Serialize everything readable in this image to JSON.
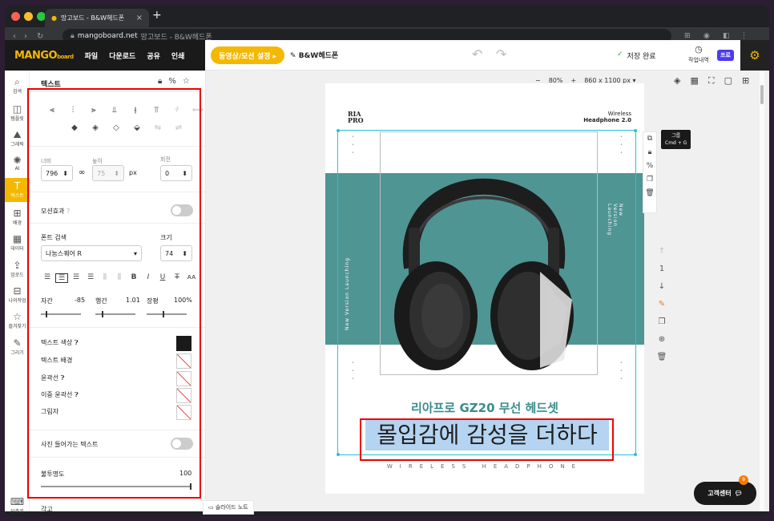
{
  "browser": {
    "tab_title": "망고보드 - B&W헤드폰",
    "url_host": "mangoboard.net",
    "url_rest": "망고보드 - B&W헤드폰"
  },
  "app": {
    "menu": [
      "파일",
      "다운로드",
      "공유",
      "인쇄"
    ],
    "motion_button": "동영상/모션 설정 ▸",
    "doc_title": "B&W헤드폰",
    "saved": "저장 완료",
    "history": "작업내역",
    "pro": "프로",
    "brand": "MANGO",
    "brand_small": "board"
  },
  "leftbar": [
    {
      "icon": "⌕",
      "label": "검색"
    },
    {
      "icon": "◫",
      "label": "템플릿"
    },
    {
      "icon": "⛰",
      "label": "그래픽"
    },
    {
      "icon": "✺",
      "label": "AI"
    },
    {
      "icon": "T",
      "label": "텍스트"
    },
    {
      "icon": "⊞",
      "label": "배경"
    },
    {
      "icon": "▦",
      "label": "데이터"
    },
    {
      "icon": "⇪",
      "label": "업로드"
    },
    {
      "icon": "⊟",
      "label": "나의작업"
    },
    {
      "icon": "☆",
      "label": "즐겨찾기"
    },
    {
      "icon": "✎",
      "label": "그리기"
    },
    {
      "icon": "⌨",
      "label": "단축키"
    }
  ],
  "panel": {
    "title": "텍스트",
    "width_label": "너비",
    "height_label": "높이",
    "rotate_label": "회전",
    "width": "796",
    "height": "75",
    "px": "px",
    "rotate": "0",
    "motion_label": "모션효과",
    "font_label": "폰트 검색",
    "size_label": "크기",
    "font": "나눔스퀘어 R",
    "size": "74",
    "spacing_label": "자간",
    "spacing": "-85",
    "lineh_label": "행간",
    "lineh": "1.01",
    "ratio_label": "장평",
    "ratio": "100%",
    "text_color": "텍스트 색상",
    "text_bg": "텍스트 배경",
    "outline": "윤곽선",
    "double_outline": "이중 윤곽선",
    "shadow": "그림자",
    "photo_text": "사진 들어가는 텍스트",
    "opacity_label": "불투명도",
    "opacity": "100",
    "cut_label": "각고"
  },
  "workspace": {
    "zoom": "80%",
    "page_size": "860 x 1100 px",
    "slide_note": "슬라이드 노트",
    "page_num": "1",
    "support": "고객센터",
    "support_badge": "9",
    "group_tip": "그룹",
    "group_shortcut": "Cmd + G"
  },
  "design": {
    "logo_top": "RIA",
    "logo_bottom": "PRO",
    "wireless": "Wireless",
    "headphone_model": "Headphone 2.0",
    "vertical_text": "New Version Launching",
    "subtitle": "리아프로 GZ20 무선 헤드셋",
    "headline": "몰입감에 감성을 더하다",
    "footer": "WIRELESS HEADPHONE"
  },
  "colors": {
    "accent": "#f5b800",
    "teal": "#4f9594",
    "selection": "#27c1d9",
    "highlight": "#b5d4f1",
    "red_box": "#e00000"
  }
}
